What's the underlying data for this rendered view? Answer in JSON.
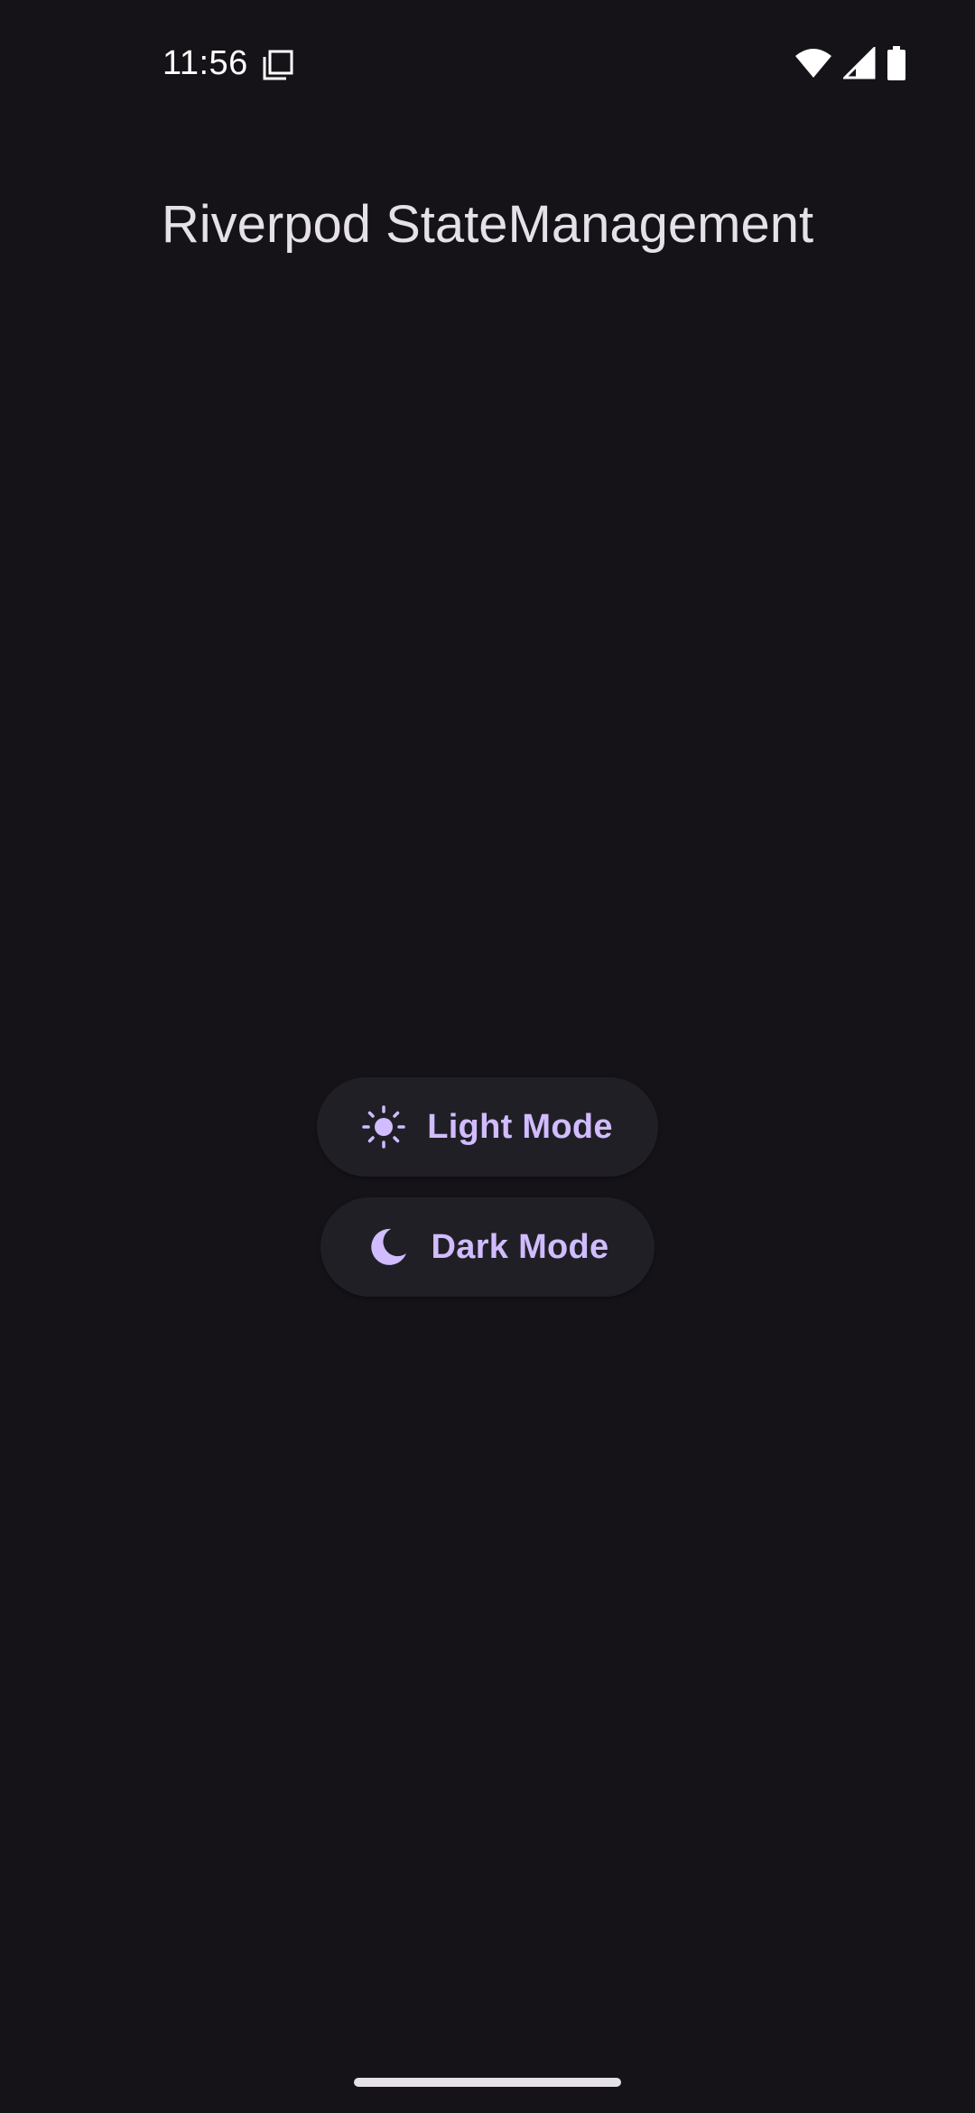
{
  "status_bar": {
    "time": "11:56",
    "icons": [
      "notification-copy-icon",
      "wifi-icon",
      "cell-signal-icon",
      "battery-icon"
    ]
  },
  "app_bar": {
    "title": "Riverpod StateManagement"
  },
  "buttons": {
    "light_mode": {
      "label": "Light Mode",
      "icon": "sun-icon"
    },
    "dark_mode": {
      "label": "Dark Mode",
      "icon": "moon-icon"
    }
  },
  "colors": {
    "background": "#151318",
    "button_surface": "#211f26",
    "accent": "#d0bcff",
    "on_surface": "#e6e0e9"
  }
}
